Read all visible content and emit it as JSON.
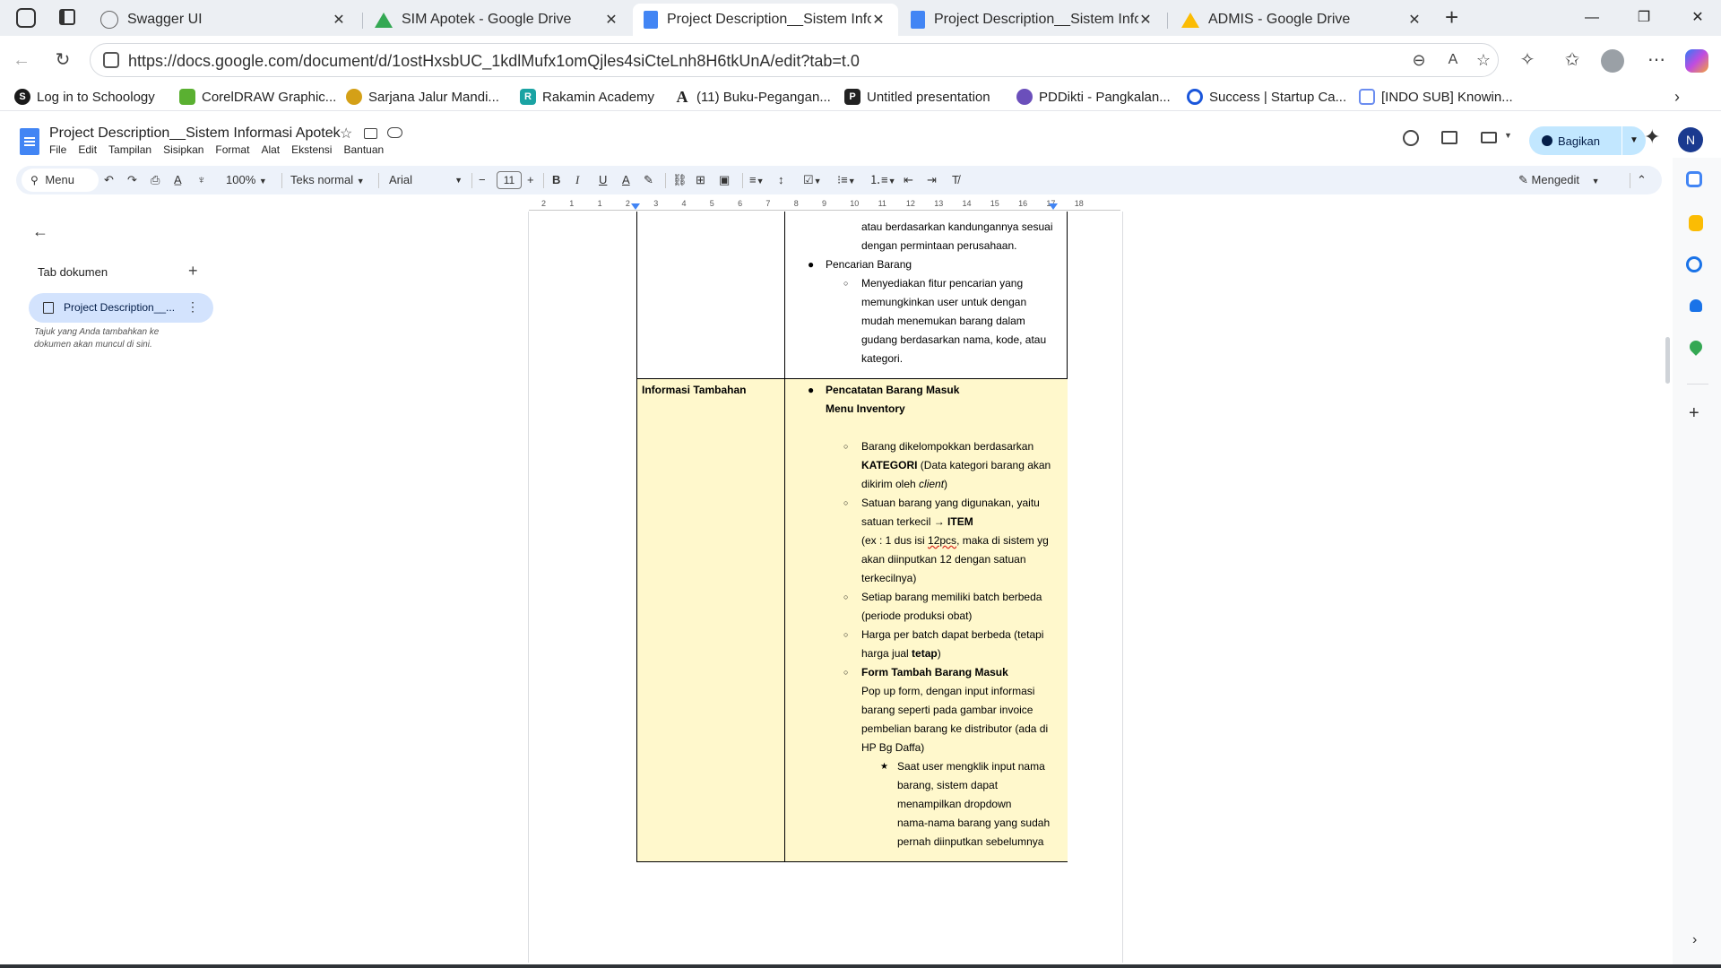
{
  "browser": {
    "tabs": [
      {
        "title": "Swagger UI"
      },
      {
        "title": "SIM Apotek - Google Drive"
      },
      {
        "title": "Project Description__Sistem Inform"
      },
      {
        "title": "Project Description__Sistem Inform"
      },
      {
        "title": "ADMIS - Google Drive"
      }
    ],
    "url": "https://docs.google.com/document/d/1ostHxsbUC_1kdlMufx1omQjles4siCteLnh8H6tkUnA/edit?tab=t.0",
    "bookmarks": [
      {
        "label": "Log in to Schoology",
        "icon": "schoology-icon",
        "color": "#1a1a1a"
      },
      {
        "label": "CorelDRAW Graphic...",
        "icon": "coreldraw-icon",
        "color": "#5ab031"
      },
      {
        "label": "Sarjana Jalur Mandi...",
        "icon": "university-icon",
        "color": "#d4a017"
      },
      {
        "label": "Rakamin Academy",
        "icon": "rakamin-icon",
        "color": "#1aa3a3"
      },
      {
        "label": "(11) Buku-Pegangan...",
        "icon": "academia-icon",
        "color": "#222222"
      },
      {
        "label": "Untitled presentation",
        "icon": "pitch-icon",
        "color": "#222222"
      },
      {
        "label": "PDDikti - Pangkalan...",
        "icon": "pddikti-icon",
        "color": "#6b4fbb"
      },
      {
        "label": "Success | Startup Ca...",
        "icon": "startup-icon",
        "color": "#1a56db"
      },
      {
        "label": "[INDO SUB] Knowin...",
        "icon": "calendar-icon",
        "color": "#6b8df0"
      }
    ]
  },
  "docs": {
    "title": "Project Description__Sistem Informasi Apotek",
    "menu": [
      "File",
      "Edit",
      "Tampilan",
      "Sisipkan",
      "Format",
      "Alat",
      "Ekstensi",
      "Bantuan"
    ],
    "share_label": "Bagikan",
    "avatar_letter": "N",
    "toolbar": {
      "search": "Menu",
      "zoom": "100%",
      "style": "Teks normal",
      "font": "Arial",
      "font_size": "11",
      "mode": "Mengedit"
    },
    "sidebar": {
      "heading": "Tab dokumen",
      "tab_label": "Project Description__...",
      "hint": "Tajuk yang Anda tambahkan ke dokumen akan muncul di sini."
    },
    "ruler_ticks": [
      "2",
      "1",
      "1",
      "2",
      "3",
      "4",
      "5",
      "6",
      "7",
      "8",
      "9",
      "10",
      "11",
      "12",
      "13",
      "14",
      "15",
      "16",
      "17",
      "18"
    ]
  },
  "content": {
    "top_lines": [
      "atau berdasarkan kandungannya sesuai",
      "dengan permintaan perusahaan."
    ],
    "pencarian_title": "Pencarian Barang",
    "pencarian_lines": [
      "Menyediakan fitur pencarian yang",
      "memungkinkan user untuk dengan",
      "mudah menemukan barang dalam",
      "gudang berdasarkan nama, kode, atau",
      "kategori."
    ],
    "row_label": "Informasi Tambahan",
    "masuk_title": "Pencatatan Barang Masuk",
    "masuk_sub": "Menu Inventory",
    "item1": [
      "Barang dikelompokkan berdasarkan"
    ],
    "item1_bold": "KATEGORI",
    "item1_rest": "(Data kategori barang akan",
    "item1_line3a": "dikirim oleh",
    "item1_line3b": "client",
    "item1_line3c": ")",
    "item2_l1": "Satuan barang yang digunakan, yaitu",
    "item2_l2a": "satuan terkecil → ",
    "item2_l2b": "ITEM",
    "item2_l3a": "(ex : 1 dus isi ",
    "item2_l3b": "12pcs",
    "item2_l3c": ", maka di sistem yg",
    "item2_l4": "akan diinputkan 12 dengan satuan",
    "item2_l5": "terkecilnya)",
    "item3_l1": "Setiap barang memiliki batch berbeda",
    "item3_l2": "(periode produksi obat)",
    "item4_l1": "Harga per batch dapat berbeda (tetapi",
    "item4_l2a": "harga jual ",
    "item4_l2b": "tetap",
    "item4_l2c": ")",
    "item5_title": "Form Tambah Barang Masuk",
    "item5_lines": [
      "Pop up form, dengan input informasi",
      "barang seperti pada gambar invoice",
      "pembelian barang ke distributor (ada di",
      "HP Bg Daffa)"
    ],
    "star_lines": [
      "Saat user mengklik input nama",
      "barang, sistem dapat",
      "menampilkan dropdown",
      "nama-nama barang yang sudah",
      "pernah diinputkan sebelumnya"
    ]
  },
  "colors": {
    "highlight_cell": "#fff8cc",
    "share_bg": "#c2e7ff",
    "docs_blue": "#4285f4"
  }
}
